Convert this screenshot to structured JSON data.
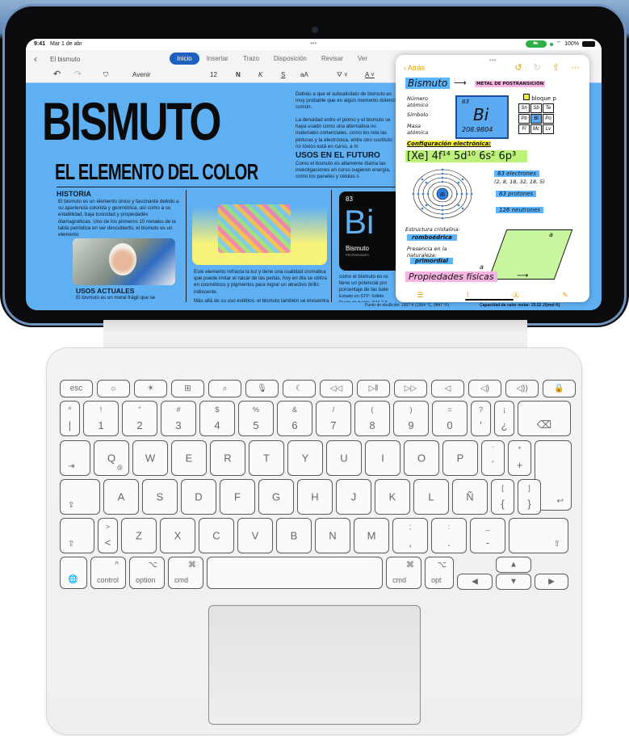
{
  "statusbar": {
    "time": "9:41",
    "date": "Mar 1 de abr",
    "battery": "100%"
  },
  "word": {
    "doc_title": "El bismuto",
    "tabs": [
      {
        "label": "Inicio",
        "active": true
      },
      {
        "label": "Insertar"
      },
      {
        "label": "Trazo"
      },
      {
        "label": "Disposición"
      },
      {
        "label": "Revisar"
      },
      {
        "label": "Ver"
      }
    ],
    "toolbar": {
      "font": "Avenir",
      "size": "12",
      "bold": "N",
      "italic": "K",
      "strike": "S",
      "case": "aA"
    },
    "document": {
      "title": "BISMUTO",
      "subtitle": "EL ELEMENTO DEL COLOR",
      "intro_text": "Debido a que el subsalicilato de bismuto es muy probable que en algún momento dolencia común.",
      "density_text": "La densidad entre el plomo y el bismuto se haya usado como una alternativa no materiales comerciales, como los rela las pinturas y la electrónica, entre otro sustituto no tóxico está en curso, a m",
      "futuro_heading": "USOS EN EL FUTURO",
      "futuro_text": "Como el bismuto es altamente diama las investigaciones en curso sugieren energía, como los paneles y células s",
      "historia_heading": "HISTORIA",
      "historia_text": "El bismuto es un elemento único y fascinante debido a su apariencia colorida y geométrica, así como a su estabilidad, baja toxicidad y propiedades diamagnéticas. Uno de los primeros 10 metales de la tabla periódica en ser descubierto, el bismuto es un elemento",
      "actuales_heading": "USOS ACTUALES",
      "actuales_text": "El bismuto es un metal frágil que se",
      "refract_text": "Este elemento refracta la luz y tiene una cualidad cromática que puede imitar el nácar de las perlas, hoy en día se utiliza en cosméticos y pigmentos para lograr un atractivo brillo iridiscente.",
      "pharma_text": "Más allá de su uso estético, el bismuto también se encuentra en muchos productos farmacéuticos.",
      "tile": {
        "number": "83",
        "symbol": "Bi",
        "name": "Bismuto",
        "caption": "PROPIEDADES"
      },
      "battery_text": "como el bismuto es re tiene un potencial pro porcentaje de las bate",
      "state": "Estado en STP: Sólido",
      "melting": "Punto de fusión: 544.7 K",
      "boiling": "Punto de ebullición: 1837 K (1564 °C, 2847 °F)",
      "heat": "Capacidad de calor molar: 25.52 J/(mol·K)"
    }
  },
  "notes": {
    "back": "Atrás",
    "title": "Bismuto",
    "category": "METAL DE POSTRANSICIÓN",
    "labels": {
      "number": "Número atómico",
      "symbol": "Símbolo",
      "mass": "Masa atómica"
    },
    "element": {
      "number": "83",
      "symbol": "Bi",
      "mass": "208.9804"
    },
    "block": "bloque p",
    "periodic": [
      "Sn",
      "Sb",
      "Te",
      "Pb",
      "Bi",
      "Po",
      "Fl",
      "Mc",
      "Lv"
    ],
    "config_label": "Configuración electrónica:",
    "config": "[Xe] 4f¹⁴ 5d¹⁰ 6s² 6p³",
    "electrons": "83 electrones",
    "shells": "(2, 8, 18, 32, 18, 5)",
    "protons": "83 protones",
    "neutrons": "126 neutrones",
    "crystal_label": "Estructura cristalina:",
    "crystal": "romboédrica",
    "presence_label": "Presencia en la naturaleza:",
    "presence": "primordial",
    "edge": "a",
    "props": "Propiedades físicas"
  },
  "keyboard": {
    "fn_row": [
      "esc",
      "☼",
      "☀",
      "⊞",
      "⌕",
      "🎙",
      "☾",
      "◁◁",
      "▷‖",
      "▷▷",
      "◁",
      "◁)",
      "◁))",
      "🔒"
    ],
    "num_row": [
      {
        "top": "º",
        "bot": "|"
      },
      {
        "top": "!",
        "bot": "1"
      },
      {
        "top": "\"",
        "bot": "2"
      },
      {
        "top": "#",
        "bot": "3"
      },
      {
        "top": "$",
        "bot": "4"
      },
      {
        "top": "%",
        "bot": "5"
      },
      {
        "top": "&",
        "bot": "6"
      },
      {
        "top": "/",
        "bot": "7"
      },
      {
        "top": "(",
        "bot": "8"
      },
      {
        "top": ")",
        "bot": "9"
      },
      {
        "top": "=",
        "bot": "0"
      },
      {
        "top": "?",
        "bot": "'"
      },
      {
        "top": "¡",
        "bot": "¿"
      },
      {
        "top": "",
        "bot": "⌫"
      }
    ],
    "q_row": [
      "Q",
      "W",
      "E",
      "R",
      "T",
      "Y",
      "U",
      "I",
      "O",
      "P"
    ],
    "q_row_sub": "@",
    "q_row_extra": [
      {
        "top": "¨",
        "bot": "´"
      },
      {
        "top": "*",
        "bot": "+"
      }
    ],
    "a_row": [
      "A",
      "S",
      "D",
      "F",
      "G",
      "H",
      "J",
      "K",
      "L",
      "Ñ"
    ],
    "a_row_extra": [
      {
        "top": "[",
        "bot": "{"
      },
      {
        "top": "]",
        "bot": "}"
      }
    ],
    "z_row_lt": {
      "top": ">",
      "bot": "<"
    },
    "z_row": [
      "Z",
      "X",
      "C",
      "V",
      "B",
      "N",
      "M"
    ],
    "z_row_extra": [
      {
        "top": ";",
        "bot": ","
      },
      {
        "top": ":",
        "bot": "."
      },
      {
        "top": "_",
        "bot": "-"
      }
    ],
    "tab": "⇥",
    "caps": "⇪",
    "shift": "⇧",
    "return": "↩",
    "globe": "🌐",
    "control": "control",
    "control_sym": "^",
    "option": "option",
    "option_sym": "⌥",
    "cmd": "cmd",
    "cmd_sym": "⌘",
    "opt": "opt",
    "arrows": {
      "left": "◀",
      "up": "▲",
      "down": "▼",
      "right": "▶"
    }
  }
}
